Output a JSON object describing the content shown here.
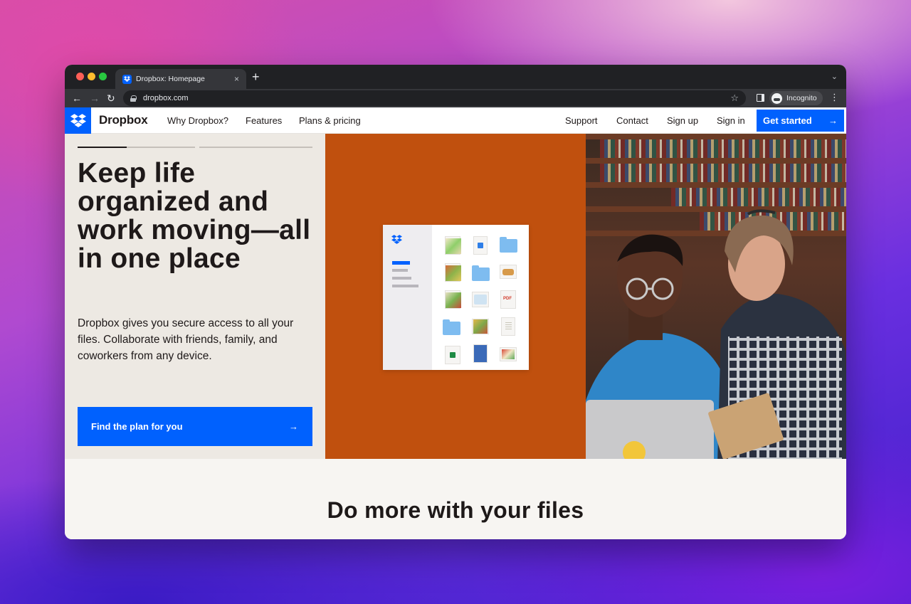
{
  "browser": {
    "tab_title": "Dropbox: Homepage",
    "tab_close": "×",
    "new_tab": "+",
    "tab_menu": "⌄",
    "url": "dropbox.com",
    "profile_label": "Incognito",
    "back": "←",
    "forward": "→",
    "reload": "↻",
    "star": "☆",
    "menu": "⋮"
  },
  "site_nav": {
    "brand": "Dropbox",
    "links": [
      "Why Dropbox?",
      "Features",
      "Plans & pricing"
    ],
    "right_links": [
      "Support",
      "Contact",
      "Sign up",
      "Sign in"
    ],
    "cta_label": "Get started",
    "cta_arrow": "→",
    "brand_color": "#0061fe"
  },
  "hero": {
    "title": "Keep life organized and work moving—all in one place",
    "subtitle": "Dropbox gives you secure access to all your files. Collaborate with friends, family, and coworkers from any device.",
    "cta_label": "Find the plan for you",
    "cta_arrow": "→",
    "middle_panel_color": "#c0500e",
    "file_badge_pdf": "PDF"
  },
  "section": {
    "title": "Do more with your files"
  }
}
